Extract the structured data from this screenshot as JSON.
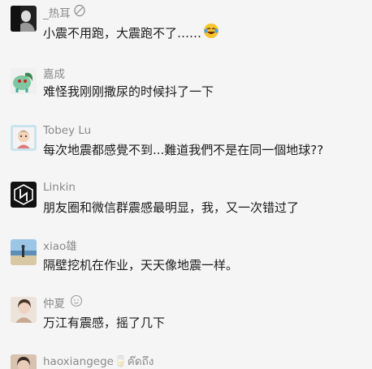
{
  "comments": [
    {
      "name": "_热耳",
      "text": "小震不用跑，大震跑不了……",
      "avatar_icon": "dark-portrait-icon",
      "name_badge": "leaf-icon",
      "text_emoji": "laughing-tears-emoji"
    },
    {
      "name": "嘉成",
      "text": "难怪我刚刚撒尿的时候抖了一下",
      "avatar_icon": "green-creature-icon"
    },
    {
      "name": "Tobey Lu",
      "text": "每次地震都感覺不到...難道我們不是在同一個地球??",
      "avatar_icon": "cartoon-portrait-icon"
    },
    {
      "name": "Linkin",
      "text": "朋友圈和微信群震感最明显，我，又一次错过了",
      "avatar_icon": "linkin-park-logo-icon"
    },
    {
      "name": "xiao雄",
      "text": "隔壁挖机在作业，天天像地震一样。",
      "avatar_icon": "beach-photo-icon"
    },
    {
      "name": "仲夏",
      "text": "万江有震感，摇了几下",
      "avatar_icon": "girl-photo-icon",
      "name_badge": "smile-badge-icon"
    },
    {
      "name": "haoxiangege🥛ค๊ดถึง",
      "text": "",
      "avatar_icon": "person-photo-icon"
    }
  ]
}
